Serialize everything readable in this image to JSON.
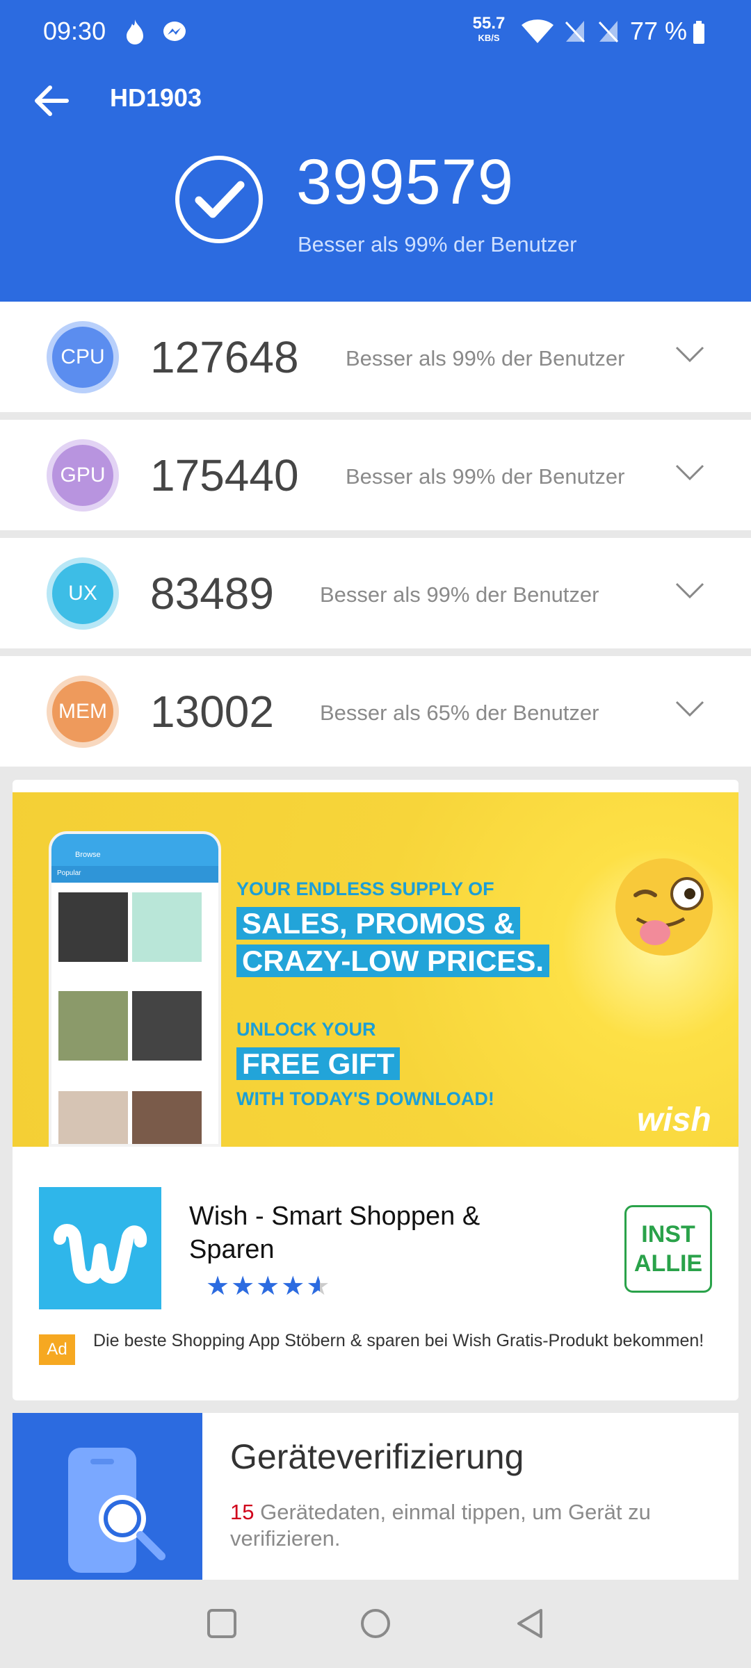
{
  "status_bar": {
    "time": "09:30",
    "net_speed_value": "55.7",
    "net_speed_unit": "KB/S",
    "battery": "77 %"
  },
  "appbar": {
    "title": "HD1903",
    "back_icon": "arrow-left-icon"
  },
  "summary": {
    "total_score": "399579",
    "subtitle": "Besser als 99% der Benutzer"
  },
  "scores": [
    {
      "label": "CPU",
      "value": "127648",
      "note": "Besser als 99% der Benutzer",
      "color": "#5b8def",
      "ring": "#b9d0fb"
    },
    {
      "label": "GPU",
      "value": "175440",
      "note": "Besser als 99% der Benutzer",
      "color": "#b894df",
      "ring": "#e2d3f4"
    },
    {
      "label": "UX",
      "value": "83489",
      "note": "Besser als 99% der Benutzer",
      "color": "#3dbde6",
      "ring": "#b8e7f6"
    },
    {
      "label": "MEM",
      "value": "13002",
      "note": "Besser als 65% der Benutzer",
      "color": "#ee9a5c",
      "ring": "#f8d8bf"
    }
  ],
  "ad": {
    "banner": {
      "line1": "YOUR ENDLESS SUPPLY OF",
      "line2": "SALES, PROMOS &",
      "line3": "CRAZY-LOW PRICES.",
      "line4": "UNLOCK YOUR",
      "line5": "FREE GIFT",
      "line6": "WITH TODAY'S DOWNLOAD!",
      "brand": "wish",
      "phone_header": "Browse",
      "phone_tab": "Popular"
    },
    "app_name": "Wish - Smart Shoppen & Sparen",
    "rating": 4.5,
    "install_label_line1": "INST",
    "install_label_line2": "ALLIE",
    "badge": "Ad",
    "description": "Die beste Shopping App Stöbern & sparen bei Wish Gratis-Produkt bekommen!"
  },
  "verify": {
    "title": "Geräteverifizierung",
    "count": "15",
    "description": " Gerätedaten, einmal tippen, um Gerät zu verifizieren."
  },
  "colors": {
    "header_blue": "#2c6be0",
    "install_green": "#2aa24a",
    "ad_badge": "#f6a821"
  }
}
